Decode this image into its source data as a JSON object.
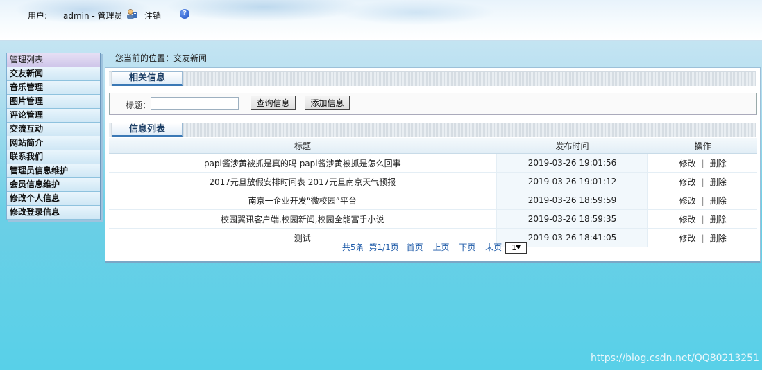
{
  "header": {
    "user_label": "用户:",
    "user_name": "admin - 管理员",
    "logout": "注销",
    "help_glyph": "?"
  },
  "sidebar": {
    "title": "管理列表",
    "items": [
      {
        "label": "交友新闻"
      },
      {
        "label": "音乐管理"
      },
      {
        "label": "图片管理"
      },
      {
        "label": "评论管理"
      },
      {
        "label": "交流互动"
      },
      {
        "label": "网站简介"
      },
      {
        "label": "联系我们"
      },
      {
        "label": "管理员信息维护"
      },
      {
        "label": "会员信息维护"
      },
      {
        "label": "修改个人信息"
      },
      {
        "label": "修改登录信息"
      }
    ]
  },
  "breadcrumb": "您当前的位置：交友新闻",
  "search_section": {
    "title": "相关信息",
    "field_label": "标题：",
    "field_value": "",
    "query_button": "查询信息",
    "add_button": "添加信息"
  },
  "list_section": {
    "title": "信息列表",
    "columns": {
      "title": "标题",
      "time": "发布时间",
      "op": "操作"
    },
    "rows": [
      {
        "title": "papi酱涉黄被抓是真的吗 papi酱涉黄被抓是怎么回事",
        "time": "2019-03-26 19:01:56"
      },
      {
        "title": "2017元旦放假安排时间表 2017元旦南京天气预报",
        "time": "2019-03-26 19:01:12"
      },
      {
        "title": "南京一企业开发“微校园”平台",
        "time": "2019-03-26 18:59:59"
      },
      {
        "title": "校园翼讯客户端,校园新闻,校园全能富手小说",
        "time": "2019-03-26 18:59:35"
      },
      {
        "title": "测试",
        "time": "2019-03-26 18:41:05"
      }
    ],
    "edit_label": "修改",
    "separator": "|",
    "delete_label": "删除"
  },
  "pager": {
    "total": "共5条",
    "page_info": "第1/1页",
    "first": "首页",
    "prev": "上页",
    "next": "下页",
    "last": "末页",
    "selected_page": "1"
  },
  "watermark": "https://blog.csdn.net/QQ80213251"
}
